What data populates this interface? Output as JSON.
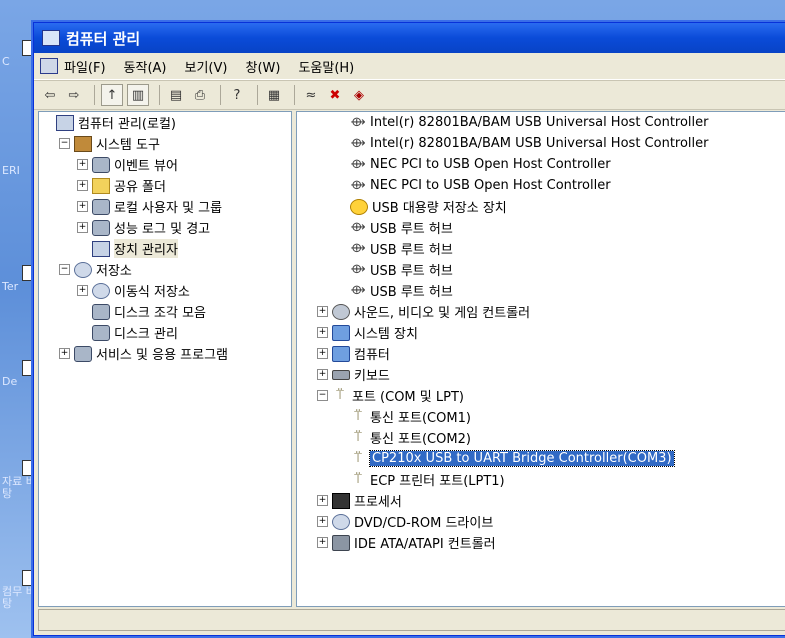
{
  "window": {
    "title": "컴퓨터 관리"
  },
  "menu": [
    "파일(F)",
    "동작(A)",
    "보기(V)",
    "창(W)",
    "도움말(H)"
  ],
  "left_tree": [
    {
      "level": 0,
      "label": "컴퓨터 관리(로컬)",
      "icon": "pc",
      "exp": ""
    },
    {
      "level": 1,
      "label": "시스템 도구",
      "icon": "tool",
      "exp": "−"
    },
    {
      "level": 2,
      "label": "이벤트 뷰어",
      "icon": "gear",
      "exp": "+"
    },
    {
      "level": 2,
      "label": "공유 폴더",
      "icon": "folder",
      "exp": "+"
    },
    {
      "level": 2,
      "label": "로컬 사용자 및 그룹",
      "icon": "gear",
      "exp": "+"
    },
    {
      "level": 2,
      "label": "성능 로그 및 경고",
      "icon": "gear",
      "exp": "+"
    },
    {
      "level": 2,
      "label": "장치 관리자",
      "icon": "pc",
      "exp": "",
      "selected_soft": true
    },
    {
      "level": 1,
      "label": "저장소",
      "icon": "disc",
      "exp": "−"
    },
    {
      "level": 2,
      "label": "이동식 저장소",
      "icon": "disc",
      "exp": "+"
    },
    {
      "level": 2,
      "label": "디스크 조각 모음",
      "icon": "gear",
      "exp": ""
    },
    {
      "level": 2,
      "label": "디스크 관리",
      "icon": "gear",
      "exp": ""
    },
    {
      "level": 1,
      "label": "서비스 및 응용 프로그램",
      "icon": "gear",
      "exp": "+"
    }
  ],
  "right_tree": [
    {
      "level": 2,
      "label": "Intel(r) 82801BA/BAM USB Universal Host Controller",
      "icon": "usb",
      "exp": ""
    },
    {
      "level": 2,
      "label": "Intel(r) 82801BA/BAM USB Universal Host Controller",
      "icon": "usb",
      "exp": ""
    },
    {
      "level": 2,
      "label": "NEC PCI to USB Open Host Controller",
      "icon": "usb",
      "exp": ""
    },
    {
      "level": 2,
      "label": "NEC PCI to USB Open Host Controller",
      "icon": "usb",
      "exp": ""
    },
    {
      "level": 2,
      "label": "USB 대용량 저장소 장치",
      "icon": "warn",
      "exp": ""
    },
    {
      "level": 2,
      "label": "USB 루트 허브",
      "icon": "usb",
      "exp": ""
    },
    {
      "level": 2,
      "label": "USB 루트 허브",
      "icon": "usb",
      "exp": ""
    },
    {
      "level": 2,
      "label": "USB 루트 허브",
      "icon": "usb",
      "exp": ""
    },
    {
      "level": 2,
      "label": "USB 루트 허브",
      "icon": "usb",
      "exp": ""
    },
    {
      "level": 1,
      "label": "사운드, 비디오 및 게임 컨트롤러",
      "icon": "snd",
      "exp": "+"
    },
    {
      "level": 1,
      "label": "시스템 장치",
      "icon": "sys",
      "exp": "+"
    },
    {
      "level": 1,
      "label": "컴퓨터",
      "icon": "sys",
      "exp": "+"
    },
    {
      "level": 1,
      "label": "키보드",
      "icon": "kbd",
      "exp": "+"
    },
    {
      "level": 1,
      "label": "포트 (COM 및 LPT)",
      "icon": "plug",
      "exp": "−"
    },
    {
      "level": 2,
      "label": "통신 포트(COM1)",
      "icon": "plug",
      "exp": ""
    },
    {
      "level": 2,
      "label": "통신 포트(COM2)",
      "icon": "plug",
      "exp": ""
    },
    {
      "level": 2,
      "label": "CP210x USB to UART Bridge Controller(COM3)",
      "icon": "plug",
      "exp": "",
      "selected": true
    },
    {
      "level": 2,
      "label": "ECP 프린터 포트(LPT1)",
      "icon": "plug",
      "exp": ""
    },
    {
      "level": 1,
      "label": "프로세서",
      "icon": "cpu",
      "exp": "+"
    },
    {
      "level": 1,
      "label": "DVD/CD-ROM 드라이브",
      "icon": "disc",
      "exp": "+"
    },
    {
      "level": 1,
      "label": "IDE ATA/ATAPI 컨트롤러",
      "icon": "ide",
      "exp": "+"
    }
  ],
  "desktop_icons": [
    "C",
    "ERI",
    "Ter",
    "De",
    "자료 바탕",
    "컴무 바탕"
  ],
  "colors": {
    "title": "#0a4bd8",
    "selection": "#316ac5"
  }
}
